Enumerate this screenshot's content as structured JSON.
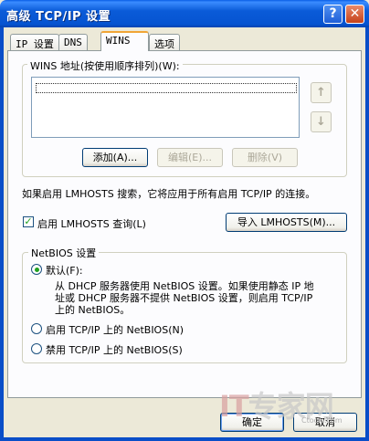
{
  "window": {
    "title": "高级 TCP/IP 设置",
    "help_glyph": "?",
    "close_glyph": "✕"
  },
  "tabs": [
    {
      "label": "IP 设置"
    },
    {
      "label": "DNS"
    },
    {
      "label": "WINS"
    },
    {
      "label": "选项"
    }
  ],
  "wins": {
    "group_label": "WINS 地址(按使用顺序排列)(W):",
    "up_glyph": "↑",
    "down_glyph": "↓",
    "add_label": "添加(A)...",
    "edit_label": "编辑(E)...",
    "delete_label": "删除(V)"
  },
  "lmhosts": {
    "info_text": "如果启用 LMHOSTS 搜索，它将应用于所有启用 TCP/IP 的连接。",
    "checkbox_label": "启用 LMHOSTS 查询(L)",
    "checked": true,
    "import_label": "导入 LMHOSTS(M)..."
  },
  "netbios": {
    "group_label": "NetBIOS 设置",
    "default_label": "默认(F):",
    "default_desc_1": "从 DHCP 服务器使用 NetBIOS 设置。如果使用静态 IP 地",
    "default_desc_2": "址或 DHCP 服务器不提供 NetBIOS 设置，则启用 TCP/IP",
    "default_desc_3": "上的 NetBIOS。",
    "enable_label": "启用 TCP/IP 上的 NetBIOS(N)",
    "disable_label": "禁用 TCP/IP 上的 NetBIOS(S)",
    "selected": "default"
  },
  "footer": {
    "ok_label": "确定",
    "cancel_label": "取消"
  },
  "watermark": {
    "brand_it": "IT",
    "brand_rest": "专家网",
    "url": "Ctocio.com"
  }
}
